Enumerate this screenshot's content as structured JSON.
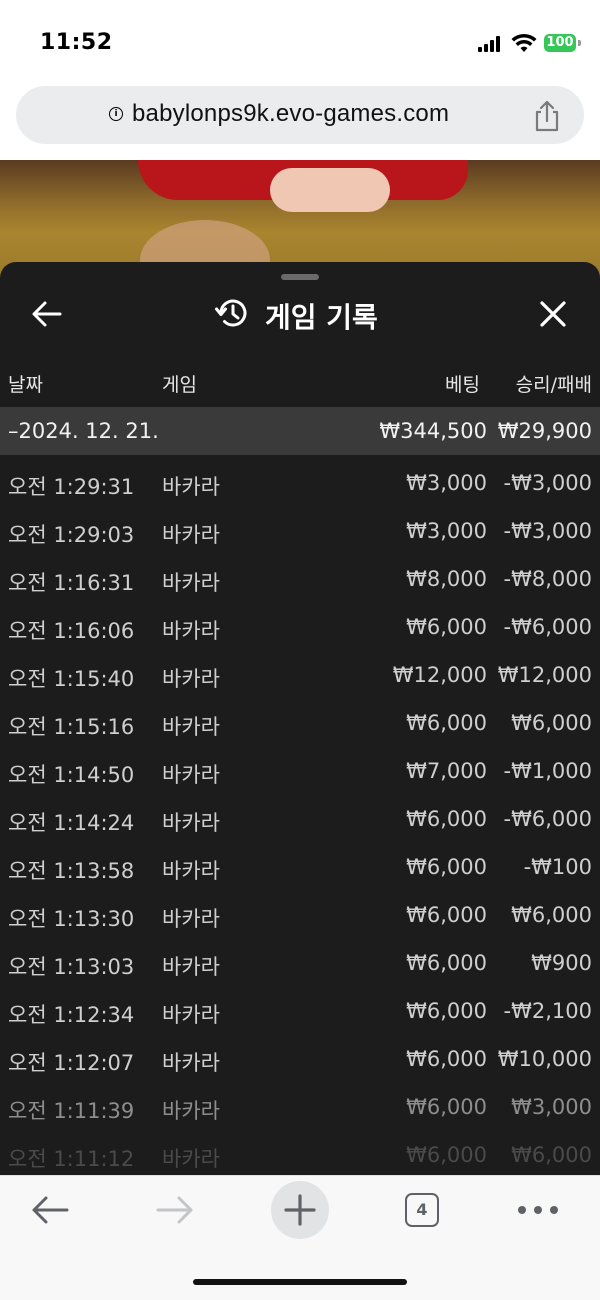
{
  "status": {
    "time": "11:52",
    "battery": "100"
  },
  "browser": {
    "url": "babylonps9k.evo-games.com",
    "tab_count": "4"
  },
  "sheet": {
    "title": "게임 기록",
    "columns": {
      "date": "날짜",
      "game": "게임",
      "bet": "베팅",
      "result": "승리/패배"
    },
    "summary": {
      "date": "–2024. 12. 21.",
      "bet": "₩344,500",
      "result": "₩29,900"
    },
    "rows": [
      {
        "time": "오전 1:29:31",
        "game": "바카라",
        "bet": "₩3,000",
        "result": "-₩3,000"
      },
      {
        "time": "오전 1:29:03",
        "game": "바카라",
        "bet": "₩3,000",
        "result": "-₩3,000"
      },
      {
        "time": "오전 1:16:31",
        "game": "바카라",
        "bet": "₩8,000",
        "result": "-₩8,000"
      },
      {
        "time": "오전 1:16:06",
        "game": "바카라",
        "bet": "₩6,000",
        "result": "-₩6,000"
      },
      {
        "time": "오전 1:15:40",
        "game": "바카라",
        "bet": "₩12,000",
        "result": "₩12,000"
      },
      {
        "time": "오전 1:15:16",
        "game": "바카라",
        "bet": "₩6,000",
        "result": "₩6,000"
      },
      {
        "time": "오전 1:14:50",
        "game": "바카라",
        "bet": "₩7,000",
        "result": "-₩1,000"
      },
      {
        "time": "오전 1:14:24",
        "game": "바카라",
        "bet": "₩6,000",
        "result": "-₩6,000"
      },
      {
        "time": "오전 1:13:58",
        "game": "바카라",
        "bet": "₩6,000",
        "result": "-₩100"
      },
      {
        "time": "오전 1:13:30",
        "game": "바카라",
        "bet": "₩6,000",
        "result": "₩6,000"
      },
      {
        "time": "오전 1:13:03",
        "game": "바카라",
        "bet": "₩6,000",
        "result": "₩900"
      },
      {
        "time": "오전 1:12:34",
        "game": "바카라",
        "bet": "₩6,000",
        "result": "-₩2,100"
      },
      {
        "time": "오전 1:12:07",
        "game": "바카라",
        "bet": "₩6,000",
        "result": "₩10,000"
      },
      {
        "time": "오전 1:11:39",
        "game": "바카라",
        "bet": "₩6,000",
        "result": "₩3,000"
      },
      {
        "time": "오전 1:11:12",
        "game": "바카라",
        "bet": "₩6,000",
        "result": "₩6,000"
      }
    ]
  },
  "icons": {
    "back": "arrow-left-icon",
    "history": "history-icon",
    "close": "close-icon",
    "info": "info-icon",
    "share": "share-icon",
    "new_tab": "plus-icon",
    "more": "more-icon"
  },
  "colors": {
    "sheet_bg": "#1c1c1c",
    "summary_bg": "#3a3a3a",
    "battery": "#35c759"
  }
}
